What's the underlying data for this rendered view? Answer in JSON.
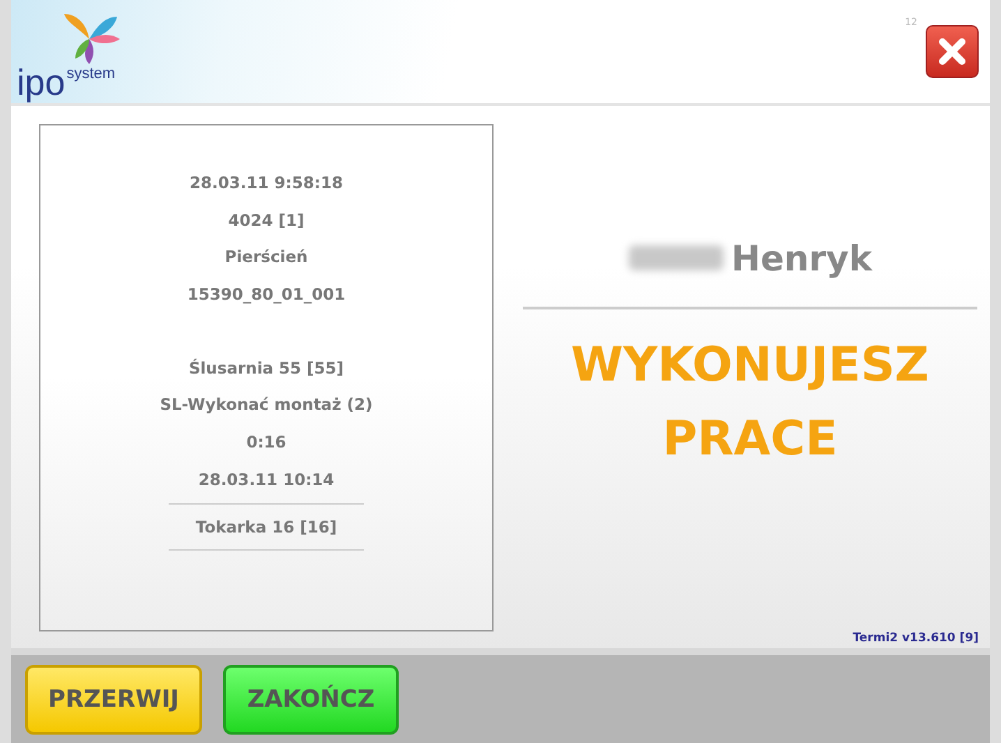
{
  "header": {
    "logo": {
      "main": "ipo",
      "sub": "system"
    },
    "corner_number": "12",
    "close_button": {
      "kind": "close"
    }
  },
  "job_panel": {
    "details": [
      "28.03.11 9:58:18",
      "4024 [1]",
      "Pierścień",
      "15390_80_01_001"
    ],
    "operation": [
      "Ślusarnia 55 [55]",
      "SL-Wykonać montaż (2)",
      "0:16",
      "28.03.11 10:14"
    ],
    "machine": "Tokarka 16 [16]"
  },
  "worker": {
    "name_redacted": true,
    "first_name": "Henryk"
  },
  "status_message": [
    "WYKONUJESZ",
    "PRACE"
  ],
  "version": "Termi2 v13.610 [9]",
  "buttons": [
    {
      "label": "PRZERWIJ",
      "kind": "pause"
    },
    {
      "label": "ZAKOŃCZ",
      "kind": "finish"
    }
  ]
}
